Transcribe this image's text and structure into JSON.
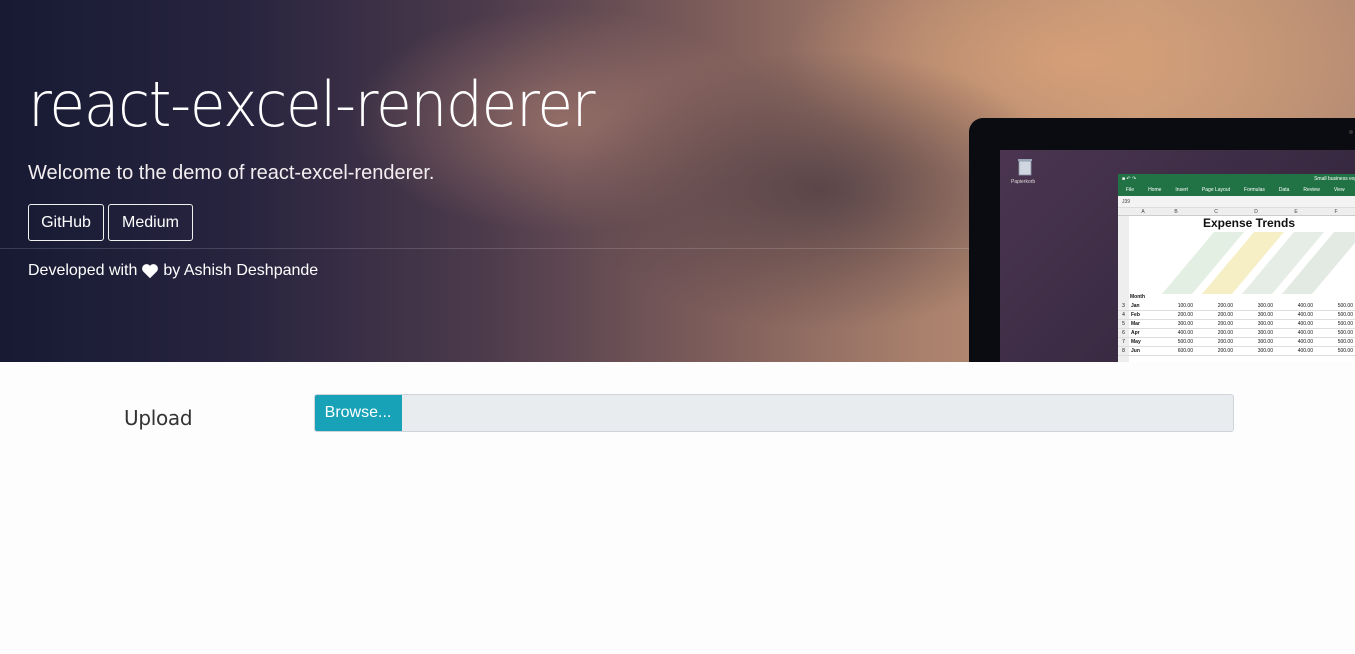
{
  "hero": {
    "title": "react-excel-renderer",
    "subtitle": "Welcome to the demo of react-excel-renderer.",
    "buttons": {
      "github": "GitHub",
      "medium": "Medium"
    },
    "credit_prefix": "Developed with",
    "credit_suffix": "by Ashish Deshpande"
  },
  "mockup": {
    "desktop_icon_label": "Papierkorb",
    "window_title": "Small business expense",
    "ribbon_tabs": [
      "File",
      "Home",
      "Insert",
      "Page Layout",
      "Formulas",
      "Data",
      "Review",
      "View"
    ],
    "name_box": "J39",
    "columns": [
      "A",
      "B",
      "C",
      "D",
      "E",
      "F"
    ],
    "sheet_heading": "Expense Trends",
    "header_row_label": "Month",
    "rows": [
      {
        "n": "3",
        "m": "Jan",
        "v": [
          "100.00",
          "200.00",
          "300.00",
          "400.00",
          "500.00"
        ]
      },
      {
        "n": "4",
        "m": "Feb",
        "v": [
          "200.00",
          "200.00",
          "300.00",
          "400.00",
          "500.00"
        ]
      },
      {
        "n": "5",
        "m": "Mar",
        "v": [
          "300.00",
          "200.00",
          "300.00",
          "400.00",
          "500.00"
        ]
      },
      {
        "n": "6",
        "m": "Apr",
        "v": [
          "400.00",
          "200.00",
          "300.00",
          "400.00",
          "500.00"
        ]
      },
      {
        "n": "7",
        "m": "May",
        "v": [
          "500.00",
          "200.00",
          "300.00",
          "400.00",
          "500.00"
        ]
      },
      {
        "n": "8",
        "m": "Jun",
        "v": [
          "600.00",
          "200.00",
          "300.00",
          "400.00",
          "500.00"
        ]
      }
    ]
  },
  "upload": {
    "label": "Upload",
    "browse_label": "Browse..."
  },
  "colors": {
    "browse_button": "#17a2b8",
    "file_input_bg": "#e9ecef",
    "excel_green": "#217346"
  }
}
